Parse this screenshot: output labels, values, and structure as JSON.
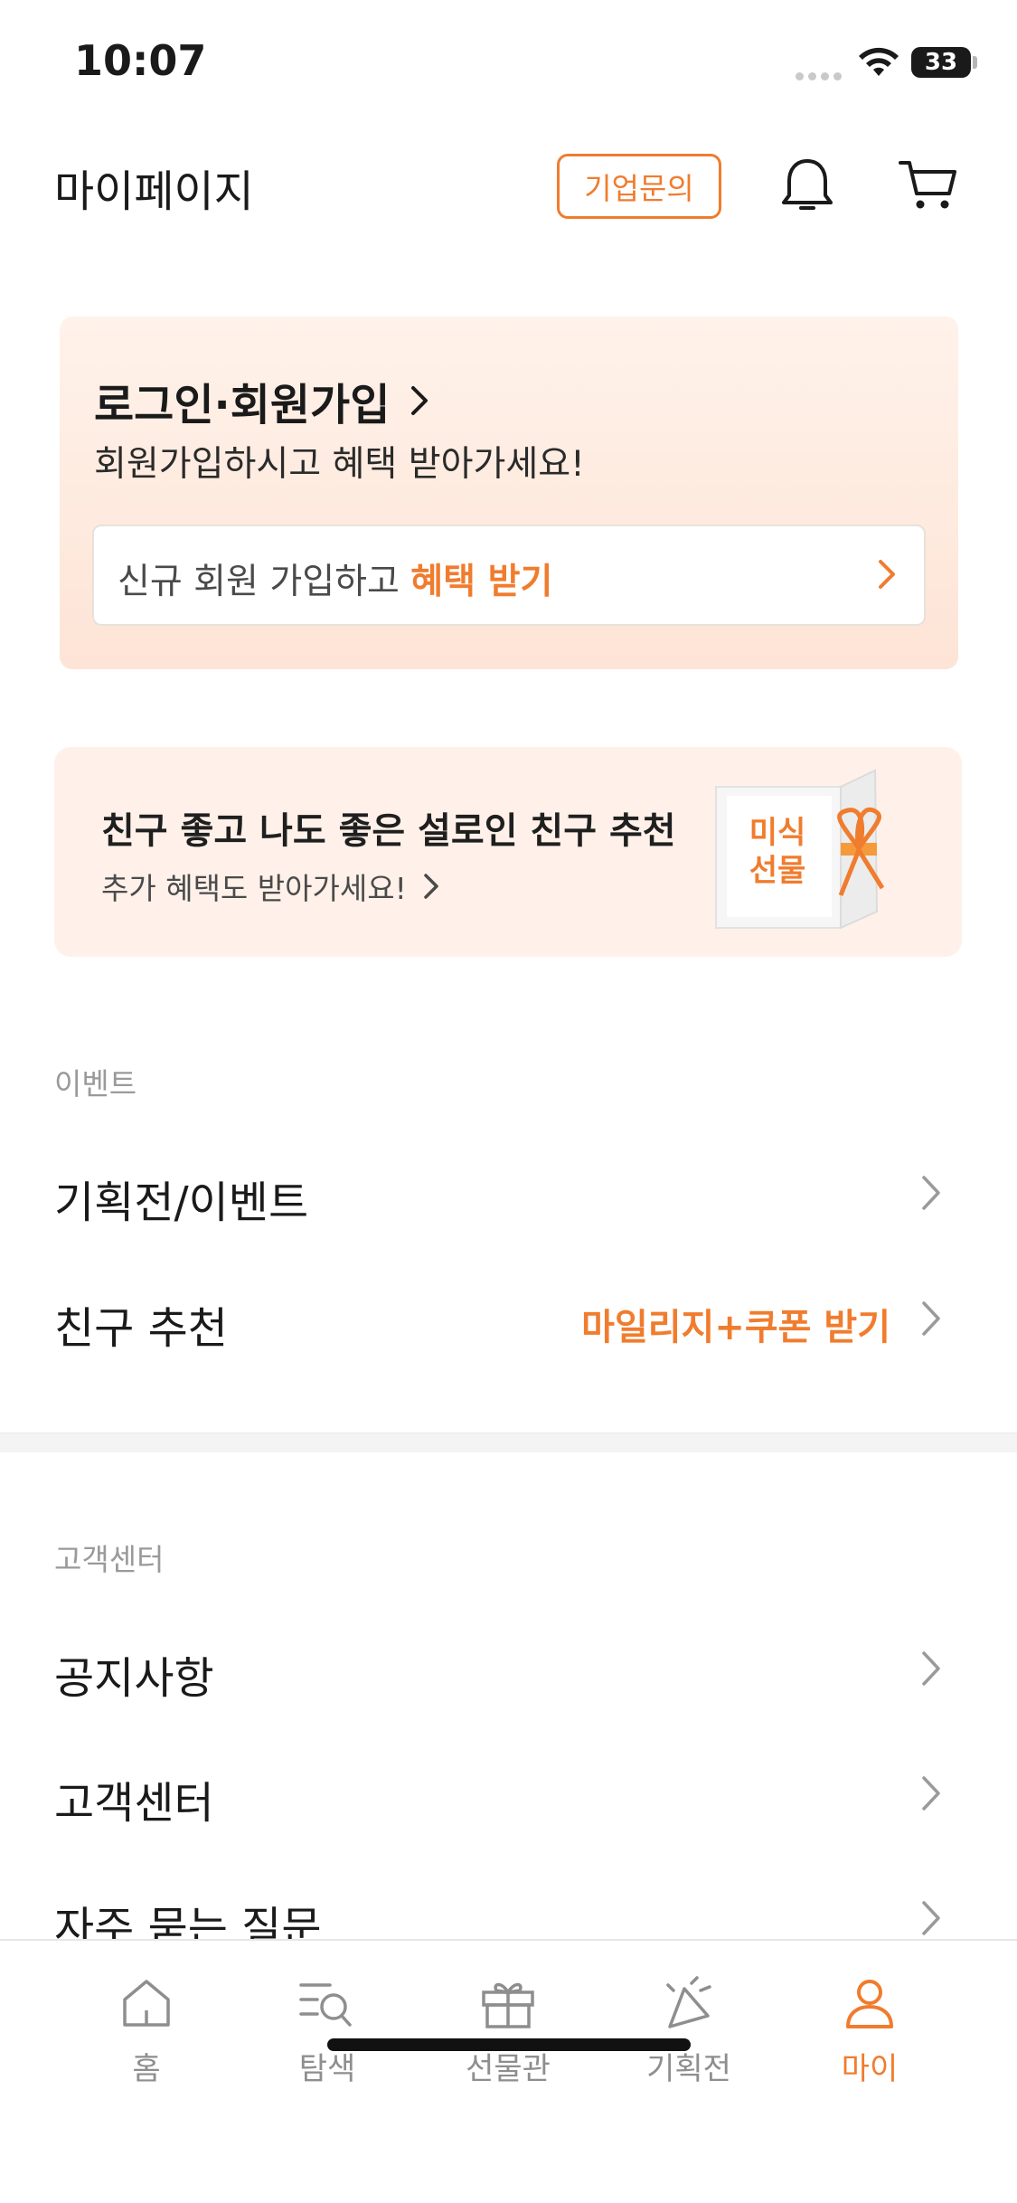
{
  "status": {
    "time": "10:07",
    "battery": "33"
  },
  "header": {
    "title": "마이페이지",
    "biz_button": "기업문의"
  },
  "login": {
    "title": "로그인·회원가입",
    "subtitle": "회원가입하시고 혜택 받아가세요!",
    "join_text": "신규 회원 가입하고 ",
    "join_highlight": "혜택 받기"
  },
  "refer_banner": {
    "title": "친구 좋고 나도 좋은 설로인 친구 추천",
    "subtitle": "추가 혜택도 받아가세요!",
    "gift_text_1": "미식",
    "gift_text_2": "선물"
  },
  "event_section": {
    "label": "이벤트",
    "items": [
      {
        "label": "기획전/이벤트",
        "right": ""
      },
      {
        "label": "친구 추천",
        "right": "마일리지+쿠폰 받기"
      }
    ]
  },
  "support_section": {
    "label": "고객센터",
    "items": [
      {
        "label": "공지사항"
      },
      {
        "label": "고객센터"
      },
      {
        "label": "자주 묻는 질문"
      }
    ]
  },
  "tabbar": {
    "tabs": [
      {
        "label": "홈",
        "icon": "home-icon"
      },
      {
        "label": "탐색",
        "icon": "explore-icon"
      },
      {
        "label": "선물관",
        "icon": "gift-icon"
      },
      {
        "label": "기획전",
        "icon": "party-icon"
      },
      {
        "label": "마이",
        "icon": "person-icon"
      }
    ],
    "active_index": 4
  },
  "colors": {
    "accent": "#f07c2e",
    "text": "#1a1a1a",
    "muted": "#9a9a9a"
  }
}
